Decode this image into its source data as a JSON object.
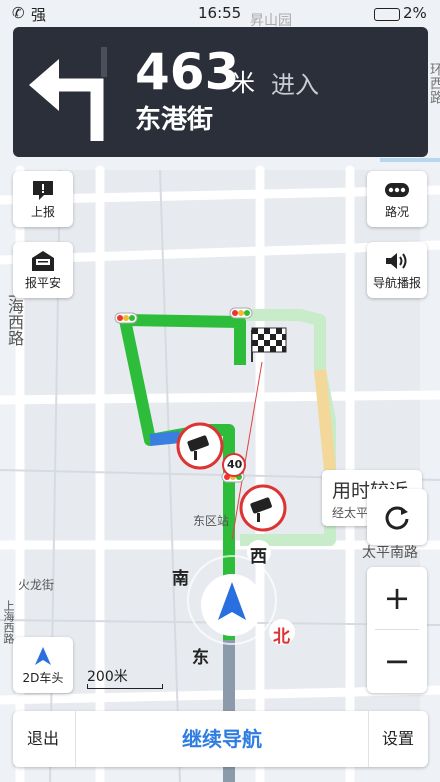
{
  "status": {
    "signal": "强",
    "time": "16:55",
    "battery": "2%"
  },
  "nav": {
    "distance": "463",
    "unit": "米",
    "action": "进入",
    "road": "东港街"
  },
  "left_buttons": {
    "report": "上报",
    "safe": "报平安",
    "heading": "2D车头"
  },
  "right_buttons": {
    "traffic": "路况",
    "voice": "导航播报"
  },
  "map": {
    "road_label_top": "昇山园",
    "road_label_left": "上海西路",
    "road_label_huolong": "火龙街",
    "road_label_haixi": "上海西路",
    "road_label_dongqu": "东区站",
    "road_label_taiping": "太平南路",
    "road_label_right": "环西路",
    "poi_card": {
      "title": "用时较近",
      "sub": "经太平"
    },
    "speed_limit": "40",
    "compass": {
      "west": "西",
      "south": "南",
      "east": "东",
      "north": "北"
    },
    "scale": "200米"
  },
  "bottom": {
    "exit": "退出",
    "continue": "继续导航",
    "settings": "设置"
  },
  "colors": {
    "route": "#2dbd3a",
    "banner": "#2b2f3a",
    "accent": "#2f7de1"
  }
}
